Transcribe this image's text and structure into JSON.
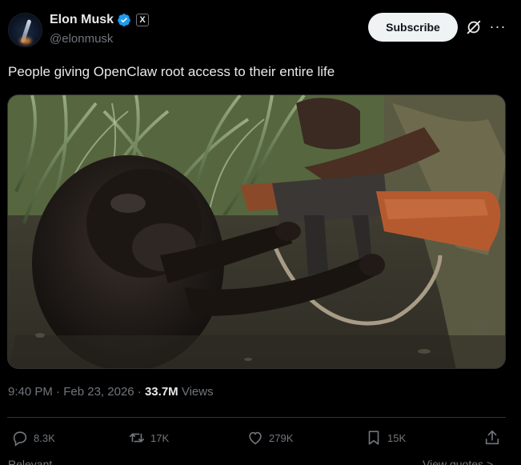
{
  "author": {
    "name": "Elon Musk",
    "handle": "@elonmusk",
    "x_badge": "X"
  },
  "header": {
    "subscribe_label": "Subscribe",
    "grok_icon": "grok-icon",
    "more_icon": "more-icon"
  },
  "tweet": {
    "text": "People giving OpenClaw root access to their entire life",
    "time": "9:40 PM",
    "separator": "·",
    "date": "Feb 23, 2026",
    "views_count": "33.7M",
    "views_label": "Views"
  },
  "actions": {
    "replies": "8.3K",
    "reposts": "17K",
    "likes": "279K",
    "bookmarks": "15K"
  },
  "footer": {
    "relevant_label": "Relevant",
    "view_quotes_label": "View quotes >"
  },
  "colors": {
    "background": "#000000",
    "text": "#e7e9ea",
    "muted": "#71767b",
    "verified": "#1d9bf0",
    "border": "#2f3336"
  }
}
